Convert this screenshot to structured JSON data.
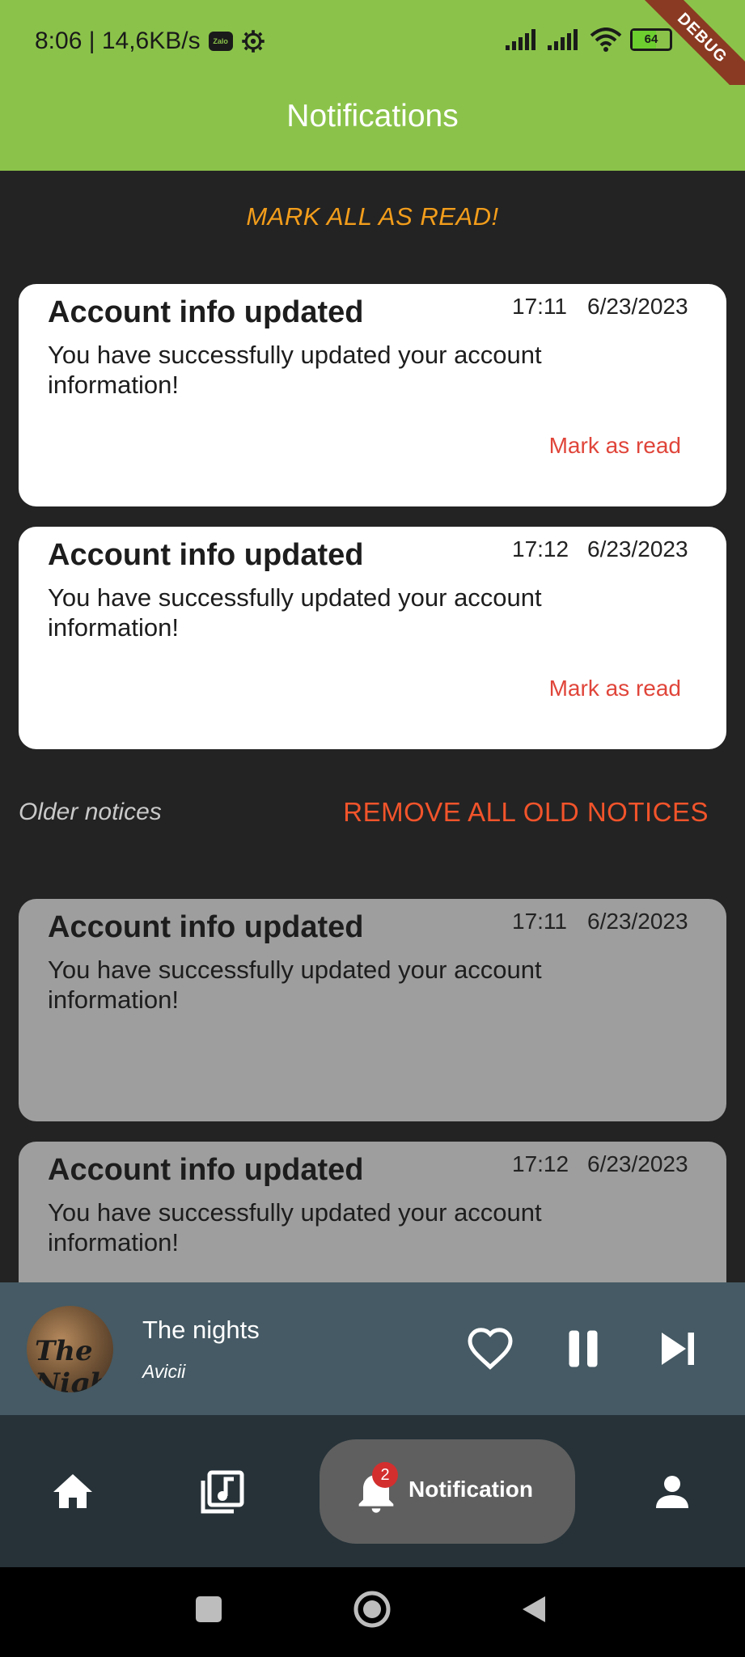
{
  "status_bar": {
    "time_speed": "8:06 | 14,6KB/s",
    "zalo_label": "Zalo",
    "battery": "64",
    "battery_level": 0.64,
    "debug_label": "DEBUG"
  },
  "app_bar": {
    "title": "Notifications"
  },
  "mark_all_label": "MARK ALL AS READ!",
  "unread_notifications": [
    {
      "title": "Account info updated",
      "time": "17:11",
      "date": "6/23/2023",
      "body": "You have successfully updated your account information!",
      "action": "Mark as read"
    },
    {
      "title": "Account info updated",
      "time": "17:12",
      "date": "6/23/2023",
      "body": "You have successfully updated your account information!",
      "action": "Mark as read"
    }
  ],
  "older_section": {
    "label": "Older notices",
    "remove_all_label": "REMOVE ALL OLD NOTICES"
  },
  "old_notifications": [
    {
      "title": "Account info updated",
      "time": "17:11",
      "date": "6/23/2023",
      "body": "You have successfully updated your account information!"
    },
    {
      "title": "Account info updated",
      "time": "17:12",
      "date": "6/23/2023",
      "body": "You have successfully updated your account information!"
    }
  ],
  "player": {
    "track_title": "The nights",
    "artist": "Avicii",
    "album_art_text": "The Nights"
  },
  "nav": {
    "active_label": "Notification",
    "badge_count": "2"
  },
  "colors": {
    "accent_green": "#8bc34a",
    "mark_all": "#f29d1b",
    "remove_old": "#f2542b",
    "mark_read": "#e0453a",
    "player_bg": "#455a64",
    "nav_bg": "#263238"
  }
}
